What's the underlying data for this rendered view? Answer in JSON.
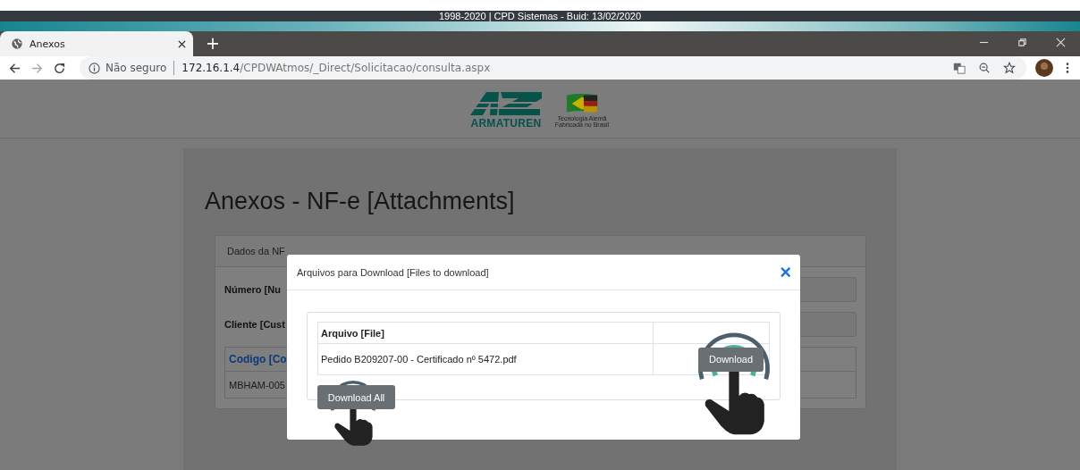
{
  "banner": {
    "text": "1998-2020 | CPD Sistemas - Buid: 13/02/2020"
  },
  "browser": {
    "tabs": [
      {
        "label": "Anexos",
        "selected": true
      }
    ],
    "new_tab": "+",
    "security": "Não seguro",
    "url_host": "172.16.1.4",
    "url_path": "/CPDWAtmos/_Direct/Solicitacao/consulta.aspx"
  },
  "header": {
    "logo_text": "ARMATUREN",
    "tagline": [
      "Tecnologia Alemã",
      "Fabricada no Brasil"
    ]
  },
  "page": {
    "title": "Anexos - NF-e [Attachments]",
    "panel_tab": "Dados da NF",
    "fields": [
      {
        "label": "Número [Nu"
      },
      {
        "label": "Cliente [Cust"
      }
    ],
    "table": {
      "column": "Codigo [Co",
      "cell": "MBHAM-005"
    }
  },
  "modal": {
    "title": "Arquivos para Download [Files to download]",
    "close": "×",
    "columns": [
      "Arquivo [File]"
    ],
    "rows": [
      {
        "file": "Pedido B209207-00 - Certificado nº 5472.pdf",
        "action": "Download"
      }
    ],
    "download_all": "Download All"
  }
}
